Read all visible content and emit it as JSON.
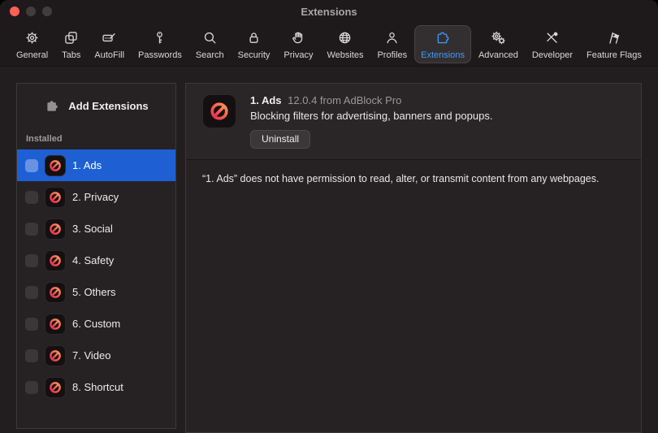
{
  "window": {
    "title": "Extensions"
  },
  "toolbar": {
    "items": [
      {
        "label": "General",
        "icon": "gear"
      },
      {
        "label": "Tabs",
        "icon": "tabs"
      },
      {
        "label": "AutoFill",
        "icon": "autofill"
      },
      {
        "label": "Passwords",
        "icon": "key"
      },
      {
        "label": "Search",
        "icon": "magnifier"
      },
      {
        "label": "Security",
        "icon": "lock"
      },
      {
        "label": "Privacy",
        "icon": "hand"
      },
      {
        "label": "Websites",
        "icon": "globe"
      },
      {
        "label": "Profiles",
        "icon": "person"
      },
      {
        "label": "Extensions",
        "icon": "puzzle",
        "selected": true
      },
      {
        "label": "Advanced",
        "icon": "gears"
      },
      {
        "label": "Developer",
        "icon": "tools"
      },
      {
        "label": "Feature Flags",
        "icon": "flags"
      }
    ]
  },
  "sidebar": {
    "add_label": "Add Extensions",
    "section_header": "Installed",
    "items": [
      {
        "label": "1. Ads",
        "checked": false,
        "selected": true
      },
      {
        "label": "2. Privacy",
        "checked": false,
        "selected": false
      },
      {
        "label": "3. Social",
        "checked": false,
        "selected": false
      },
      {
        "label": "4. Safety",
        "checked": false,
        "selected": false
      },
      {
        "label": "5. Others",
        "checked": false,
        "selected": false
      },
      {
        "label": "6. Custom",
        "checked": false,
        "selected": false
      },
      {
        "label": "7. Video",
        "checked": false,
        "selected": false
      },
      {
        "label": "8. Shortcut",
        "checked": false,
        "selected": false
      }
    ]
  },
  "main": {
    "header": {
      "name": "1. Ads",
      "version_info": "12.0.4 from AdBlock Pro",
      "description": "Blocking filters for advertising, banners and popups.",
      "uninstall_label": "Uninstall"
    },
    "permission_text": "“1. Ads” does not have permission to read, alter, or transmit content from any webpages."
  },
  "colors": {
    "accent_blue": "#3f9bfd",
    "selection_blue": "#1e60d4",
    "extension_badge_gradient": [
      "#ee2b4e",
      "#ff9357"
    ],
    "close_button_red": "#ff5f57"
  }
}
